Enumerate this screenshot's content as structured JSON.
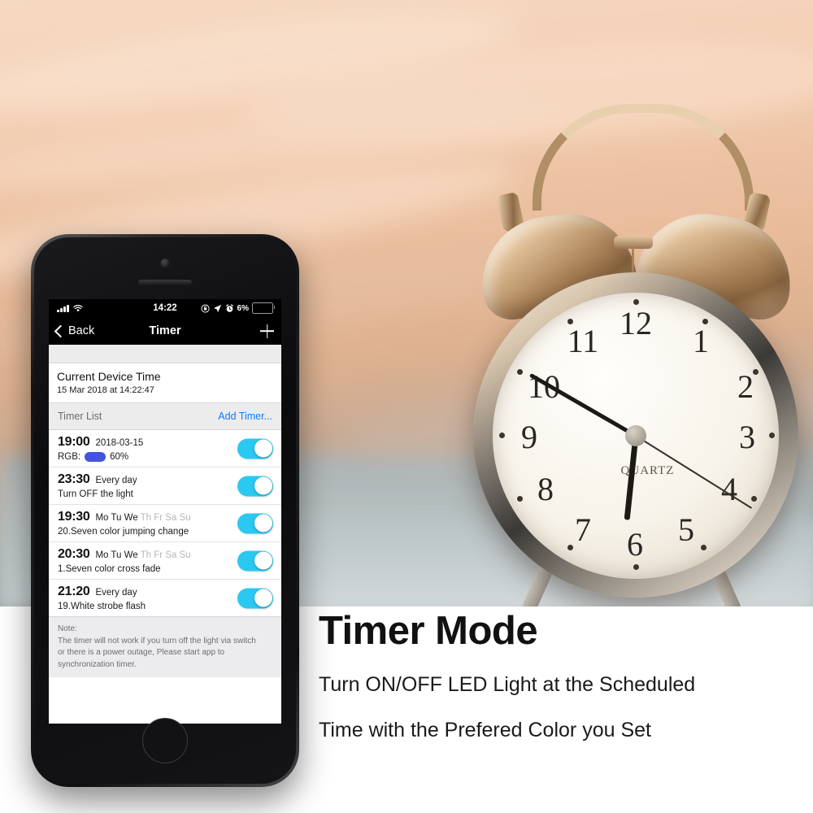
{
  "background": {
    "scene": "blurred-bedsheet-photo",
    "object": "twin-bell-alarm-clock",
    "clock_dial_brand": "QUARTZ",
    "clock_numerals": [
      "12",
      "1",
      "2",
      "3",
      "4",
      "5",
      "6",
      "7",
      "8",
      "9",
      "10",
      "11"
    ]
  },
  "phone": {
    "status_bar": {
      "signal_icon": "signal-bars-icon",
      "wifi_icon": "wifi-icon",
      "time": "14:22",
      "alarm_icon": "alarm-clock-icon",
      "location_icon": "location-arrow-icon",
      "rotation_lock_icon": "rotation-lock-icon",
      "battery_percent": "6%",
      "battery_level": 6,
      "battery_color": "#f3c623"
    },
    "nav_bar": {
      "back_label": "Back",
      "back_icon": "chevron-left-icon",
      "title": "Timer",
      "add_icon": "plus-icon"
    },
    "device_time": {
      "label": "Current Device Time",
      "value": "15 Mar 2018 at 14:22:47"
    },
    "list_header": {
      "label": "Timer List",
      "add_link": "Add Timer...",
      "link_color": "#0a7cff"
    },
    "timers": [
      {
        "time": "19:00",
        "days": "2018-03-15",
        "days_off": "",
        "detail": "60%",
        "detail_prefix": "RGB:",
        "swatch_color": "#4353e0",
        "has_swatch": true,
        "enabled": true
      },
      {
        "time": "23:30",
        "days": "Every day",
        "days_off": "",
        "detail": "Turn OFF the light",
        "detail_prefix": "",
        "has_swatch": false,
        "enabled": true
      },
      {
        "time": "19:30",
        "days": "Mo Tu We",
        "days_off": "Th Fr Sa Su",
        "detail": "20.Seven color jumping change",
        "detail_prefix": "",
        "has_swatch": false,
        "enabled": true
      },
      {
        "time": "20:30",
        "days": "Mo Tu We",
        "days_off": "Th Fr Sa Su",
        "detail": "1.Seven color cross fade",
        "detail_prefix": "",
        "has_swatch": false,
        "enabled": true
      },
      {
        "time": "21:20",
        "days": "Every day",
        "days_off": "",
        "detail": "19.White strobe flash",
        "detail_prefix": "",
        "has_swatch": false,
        "enabled": true
      }
    ],
    "toggle_on_color": "#2bc8f2",
    "note": {
      "title": "Note:",
      "line1": "The timer will not work if you turn off the light via switch",
      "line2": "or there is a power outage, Please start app to",
      "line3": "synchronization timer."
    },
    "home_button_icon": "home-button-icon"
  },
  "marketing": {
    "headline": "Timer Mode",
    "sub_line1": "Turn ON/OFF LED Light at the Scheduled",
    "sub_line2": "Time with the Prefered Color you Set"
  }
}
